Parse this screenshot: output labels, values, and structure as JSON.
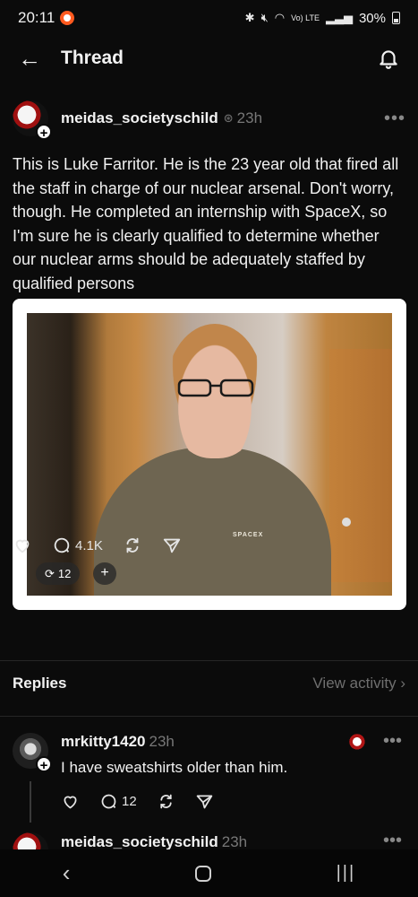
{
  "status_bar": {
    "time": "20:11",
    "network": "Vo) LTE",
    "battery": "30%"
  },
  "header": {
    "title": "Thread"
  },
  "post": {
    "username": "meidas_societyschild",
    "time": "23h",
    "text": "This is Luke Farritor. He is the 23 year old that fired all the staff in charge of our nuclear arsenal. Don't worry, though. He completed an internship with SpaceX, so I'm sure he is clearly qualified to determine whether our nuclear arms should be adequately staffed by qualified persons",
    "media": {
      "shirt_logo": "SPACEX",
      "repost_count": "12",
      "add_label": "+"
    },
    "actions": {
      "reply_count": "4.1K"
    }
  },
  "replies_section": {
    "label": "Replies",
    "view_activity": "View activity"
  },
  "reply": {
    "username": "mrkitty1420",
    "time": "23h",
    "text": "I have sweatshirts older than him.",
    "reply_count": "12"
  },
  "next_post": {
    "username": "meidas_societyschild",
    "time": "23h"
  }
}
